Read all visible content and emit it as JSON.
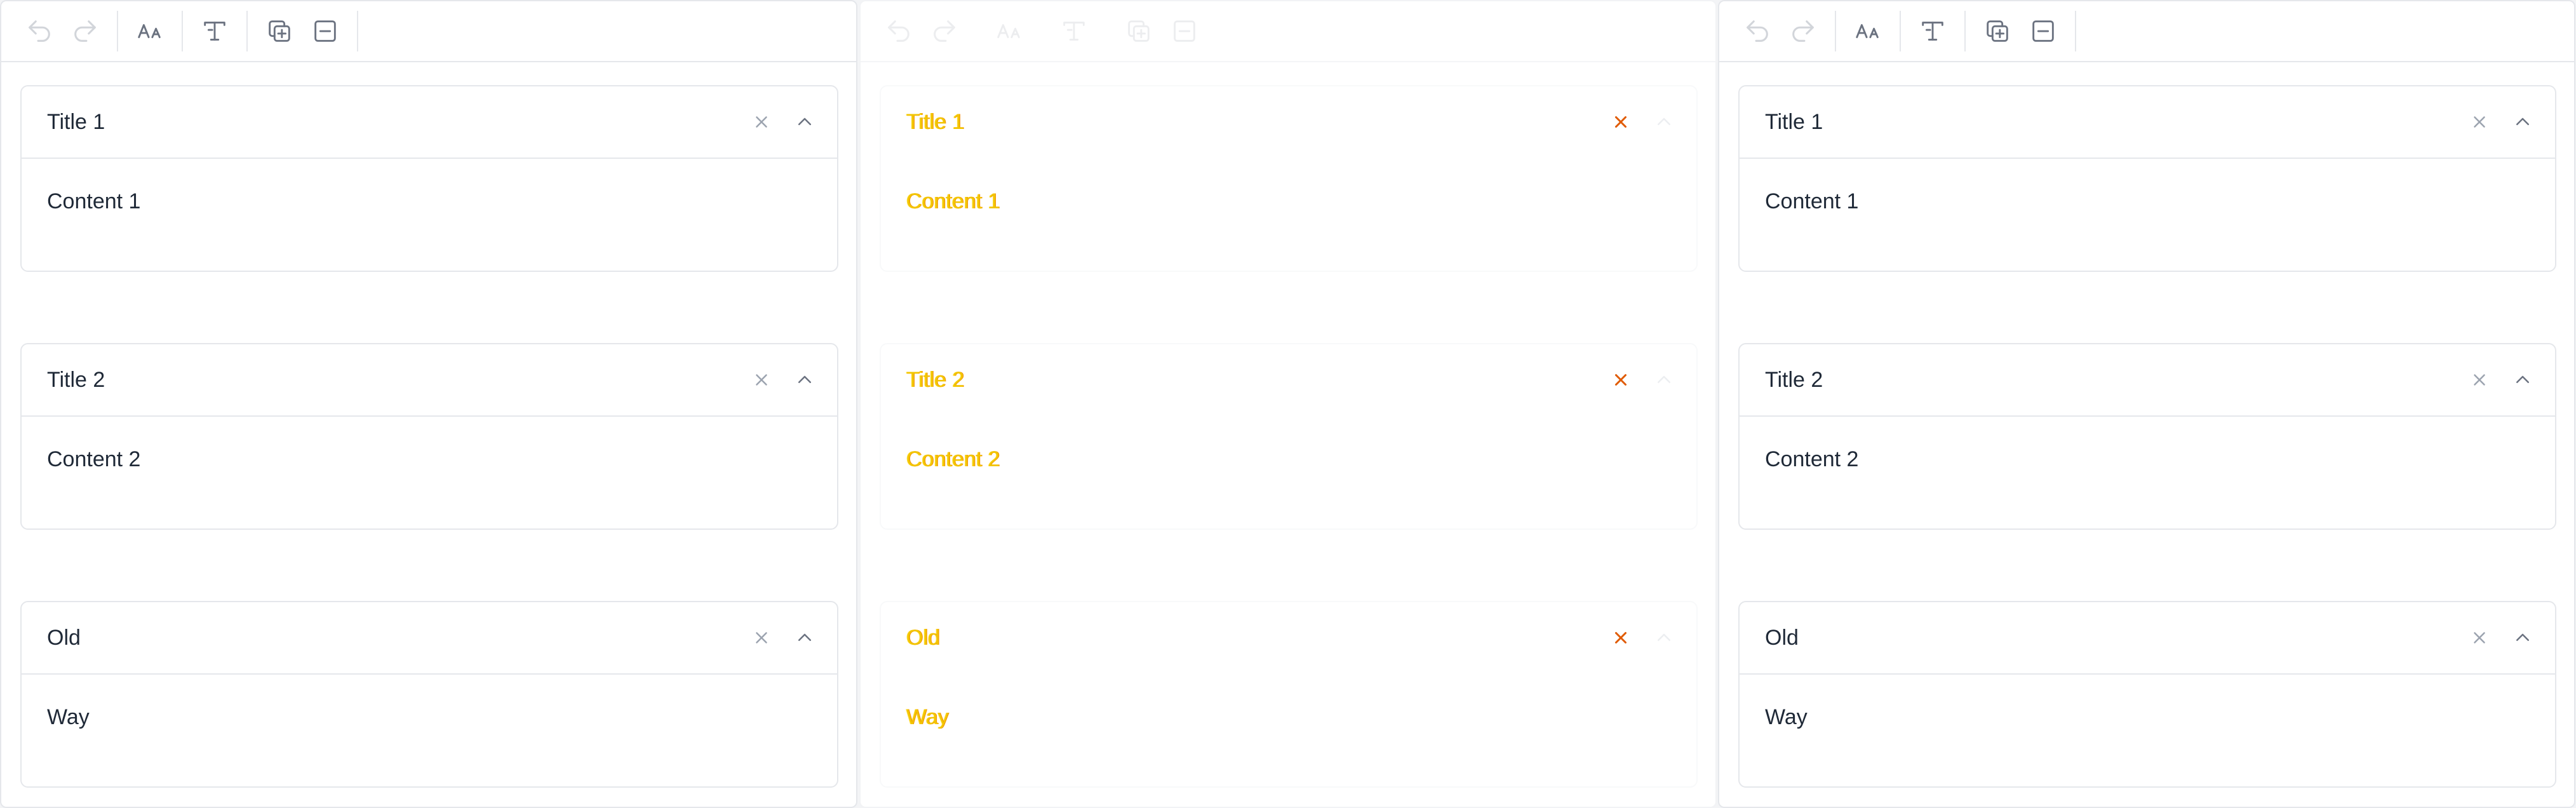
{
  "toolbar": {
    "icons": [
      "undo-icon",
      "redo-icon",
      "font-size-icon",
      "text-style-icon",
      "duplicate-icon",
      "remove-icon"
    ]
  },
  "panels": [
    {
      "id": "left",
      "items": [
        {
          "title": "Title 1",
          "content": "Content 1"
        },
        {
          "title": "Title 2",
          "content": "Content 2"
        },
        {
          "title": "Old",
          "content": "Way"
        }
      ]
    },
    {
      "id": "middle",
      "items": [
        {
          "title": "Title 1",
          "content": "Content 1"
        },
        {
          "title": "Title 2",
          "content": "Content 2"
        },
        {
          "title": "Old",
          "content": "Way"
        }
      ]
    },
    {
      "id": "right",
      "items": [
        {
          "title": "Title 1",
          "content": "Content 1"
        },
        {
          "title": "Title 2",
          "content": "Content 2"
        },
        {
          "title": "Old",
          "content": "Way"
        }
      ]
    }
  ],
  "colors": {
    "border": "#e5e7eb",
    "icon": "#9ca3af",
    "text": "#1f2937",
    "ghost_text": "#f2c500",
    "ghost_close": "#e05a00"
  }
}
